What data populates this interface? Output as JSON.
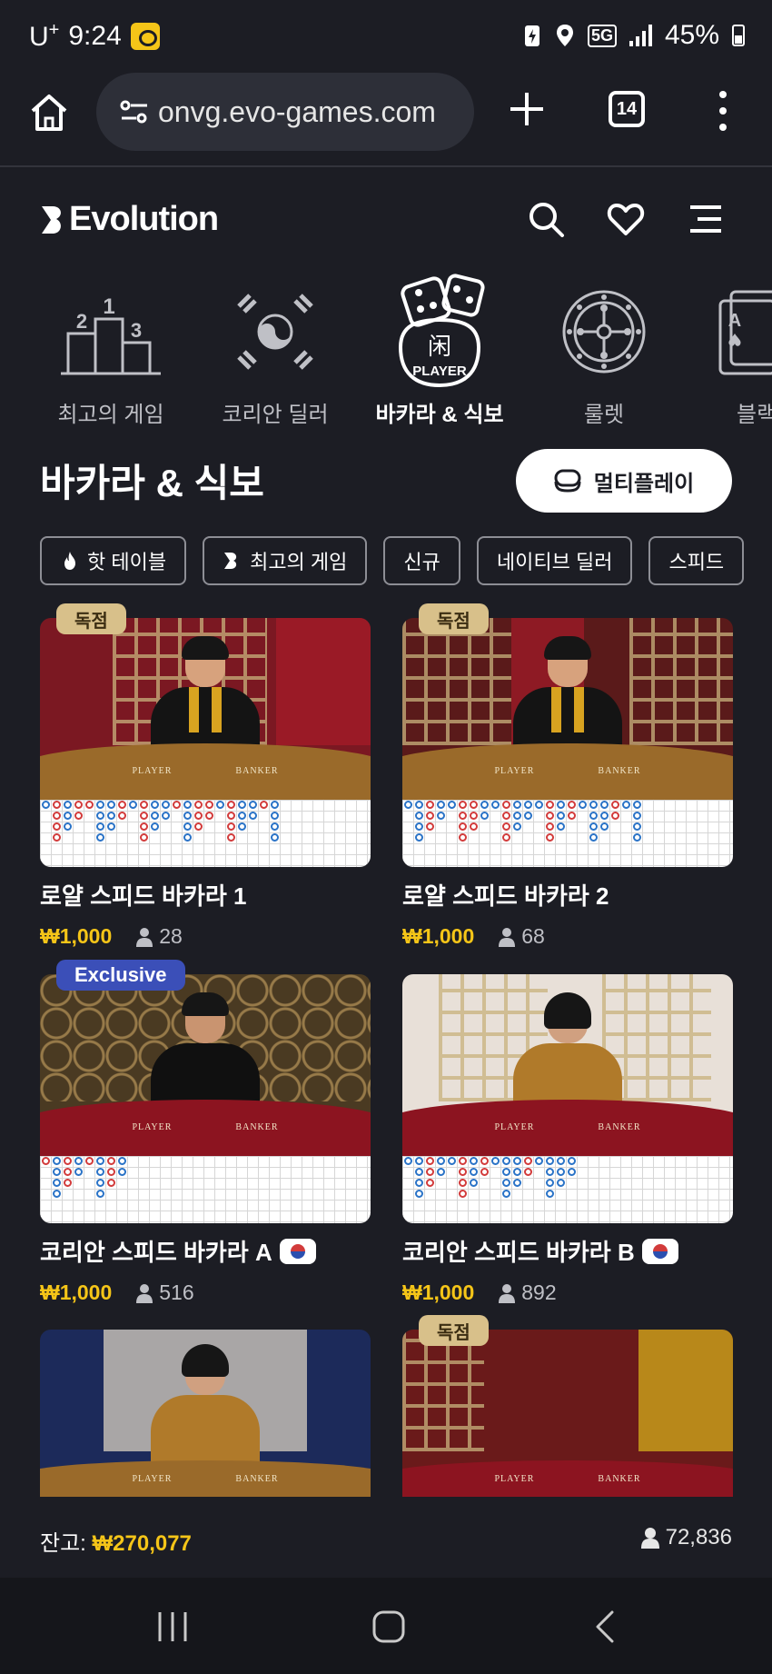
{
  "status_bar": {
    "carrier": "U",
    "carrier_sup": "+",
    "time": "9:24",
    "network": "5G",
    "battery": "45%"
  },
  "browser": {
    "url": "onvg.evo-games.com",
    "tab_count": "14"
  },
  "site": {
    "logo_text": "Evolution"
  },
  "categories": [
    {
      "label": "최고의 게임"
    },
    {
      "label": "코리안 딜러"
    },
    {
      "label": "바카라 & 식보",
      "art_text": "PLAYER",
      "art_glyph": "闲"
    },
    {
      "label": "룰렛"
    },
    {
      "label": "블랙"
    }
  ],
  "section": {
    "title": "바카라 & 식보",
    "multiplay_label": "멀티플레이"
  },
  "filters": [
    {
      "label": "핫 테이블",
      "icon": "fire-icon"
    },
    {
      "label": "최고의 게임",
      "icon": "evolution-icon"
    },
    {
      "label": "신규"
    },
    {
      "label": "네이티브 딜러"
    },
    {
      "label": "스피드"
    }
  ],
  "games": [
    {
      "name": "로얄 스피드 바카라 1",
      "price": "₩1,000",
      "players": "28",
      "badge": "독점",
      "table_player": "PLAYER",
      "table_banker": "BANKER"
    },
    {
      "name": "로얄 스피드 바카라 2",
      "price": "₩1,000",
      "players": "68",
      "badge": "독점",
      "table_player": "PLAYER",
      "table_banker": "BANKER"
    },
    {
      "name": "코리안 스피드 바카라 A",
      "price": "₩1,000",
      "players": "516",
      "badge": "Exclusive",
      "table_player": "PLAYER",
      "table_banker": "BANKER"
    },
    {
      "name": "코리안 스피드 바카라 B",
      "price": "₩1,000",
      "players": "892",
      "badge": "",
      "table_player": "PLAYER",
      "table_banker": "BANKER"
    },
    {
      "name": "",
      "badge": "",
      "table_player": "PLAYER",
      "table_banker": "BANKER"
    },
    {
      "name": "",
      "badge": "독점",
      "table_player": "PLAYER",
      "table_banker": "BANKER"
    }
  ],
  "balance": {
    "label": "잔고:",
    "amount": "₩270,077",
    "online_count": "72,836"
  },
  "colors": {
    "background": "#1c1d24",
    "price": "#f5c518",
    "exclusive_badge": "#3b4fb8",
    "dokjeom_badge": "#d8c08a"
  }
}
